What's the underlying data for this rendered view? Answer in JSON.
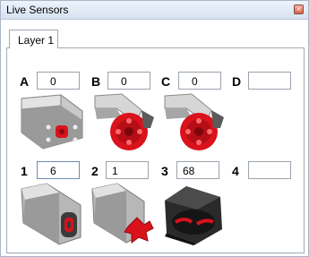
{
  "window": {
    "title": "Live Sensors",
    "close_glyph": "×"
  },
  "tabs": [
    {
      "label": "Layer 1"
    }
  ],
  "motor_ports": [
    {
      "label": "A",
      "value": "0",
      "device": "medium-motor"
    },
    {
      "label": "B",
      "value": "0",
      "device": "large-motor"
    },
    {
      "label": "C",
      "value": "0",
      "device": "large-motor"
    },
    {
      "label": "D",
      "value": "",
      "device": ""
    }
  ],
  "sensor_ports": [
    {
      "label": "1",
      "value": "6",
      "device": "ultrasonic-sensor"
    },
    {
      "label": "2",
      "value": "1",
      "device": "touch-sensor"
    },
    {
      "label": "3",
      "value": "68",
      "device": "infrared-sensor"
    },
    {
      "label": "4",
      "value": "",
      "device": ""
    }
  ],
  "colors": {
    "motor_red": "#d9121b",
    "sensor_gray": "#8c8c8c",
    "frame": "#a9b7c9"
  }
}
